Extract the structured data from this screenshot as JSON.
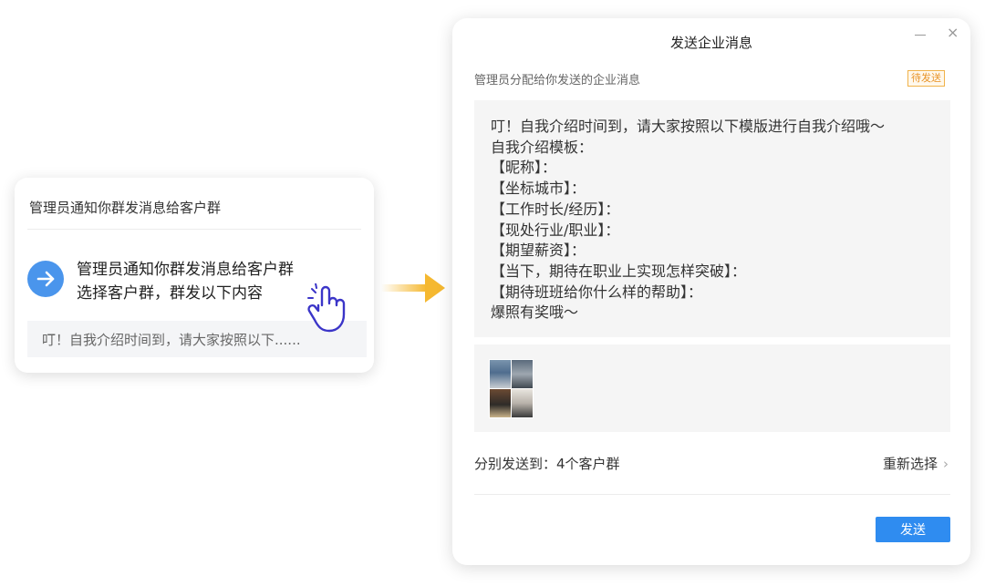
{
  "notification": {
    "header": "管理员通知你群发消息给客户群",
    "line1": "管理员通知你群发消息给客户群",
    "line2": "选择客户群，群发以下内容",
    "preview": "叮！自我介绍时间到，请大家按照以下......"
  },
  "dialog": {
    "title": "发送企业消息",
    "subtitle": "管理员分配给你发送的企业消息",
    "status_badge": "待发送",
    "minimize_icon": "minimize-icon",
    "close_glyph": "×",
    "message_lines": [
      "叮！自我介绍时间到，请大家按照以下模版进行自我介绍哦～",
      "自我介绍模板：",
      "【昵称】：",
      "【坐标城市】：",
      "【工作时长/经历】：",
      "【现处行业/职业】：",
      "【期望薪资】：",
      "【当下，期待在职业上实现怎样突破】：",
      "【期待班班给你什么样的帮助】：",
      "爆照有奖哦～"
    ],
    "send_to": "分别发送到：4个客户群",
    "reselect": "重新选择",
    "send_button": "发送"
  },
  "colors": {
    "primary_blue": "#2f8cf0",
    "badge_orange": "#e8952a",
    "connector_yellow": "#f5b830",
    "arrow_circle": "#4a95ec"
  }
}
